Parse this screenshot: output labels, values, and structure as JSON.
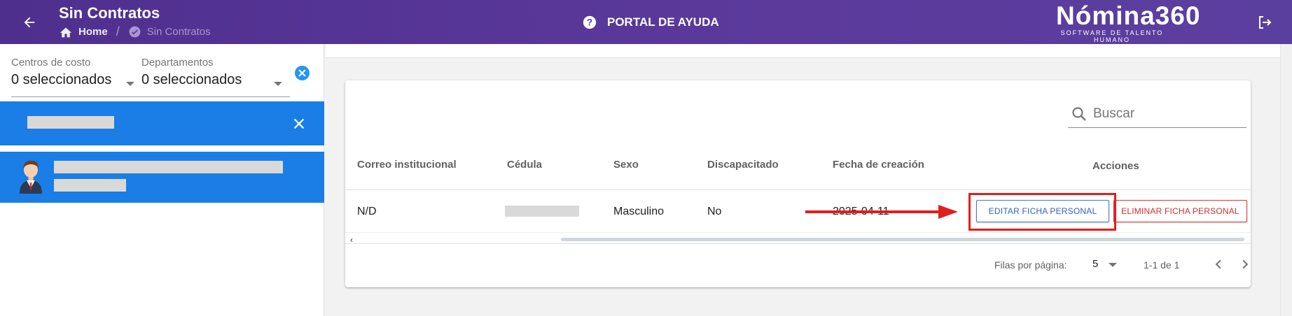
{
  "header": {
    "title": "Sin Contratos",
    "breadcrumb": {
      "home": "Home",
      "current": "Sin Contratos"
    },
    "help_link": "PORTAL DE AYUDA",
    "logo": {
      "name": "Nómina360",
      "tagline": "SOFTWARE DE TALENTO HUMANO"
    },
    "colors": {
      "bar": "#5b3a9c",
      "accent_blue": "#1a7ee6"
    }
  },
  "filters": {
    "cost_centers": {
      "label": "Centros de costo",
      "value": "0 seleccionados"
    },
    "departments": {
      "label": "Departamentos",
      "value": "0 seleccionados"
    }
  },
  "search": {
    "placeholder": "Buscar"
  },
  "table": {
    "columns": [
      "Correo institucional",
      "Cédula",
      "Sexo",
      "Discapacitado",
      "Fecha de creación",
      "Acciones"
    ],
    "rows": [
      {
        "correo": "N/D",
        "sexo": "Masculino",
        "discapacitado": "No",
        "fecha": "2025-04-11",
        "edit_label": "EDITAR FICHA PERSONAL",
        "delete_label": "ELIMINAR FICHA PERSONAL"
      }
    ]
  },
  "pagination": {
    "rows_label": "Filas por página:",
    "rows_value": "5",
    "range": "1-1 de 1"
  }
}
